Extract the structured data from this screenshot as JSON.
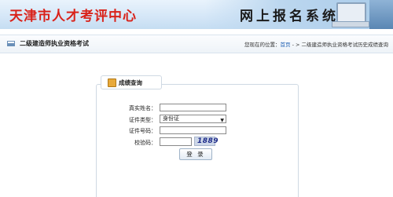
{
  "header": {
    "org_title": "天津市人才考评中心",
    "banner_text": "网上报名系统"
  },
  "breadcrumb_bar": {
    "page_title": "二级建造师执业资格考试",
    "location_label": "您现在的位置：",
    "home_link": "首页",
    "separator": " - > ",
    "current": "二级建造师执业资格考试历史成绩查询"
  },
  "form": {
    "panel_title": "成绩查询",
    "name_label": "真实姓名：",
    "name_value": "",
    "id_type_label": "证件类型：",
    "id_type_selected": "身份证",
    "id_number_label": "证件号码：",
    "id_number_value": "",
    "captcha_label": "校验码：",
    "captcha_value": "",
    "captcha_image_text": "1889",
    "submit_label": "登 录"
  },
  "colors": {
    "header_title": "#d9221a",
    "link": "#1f5fb3"
  }
}
